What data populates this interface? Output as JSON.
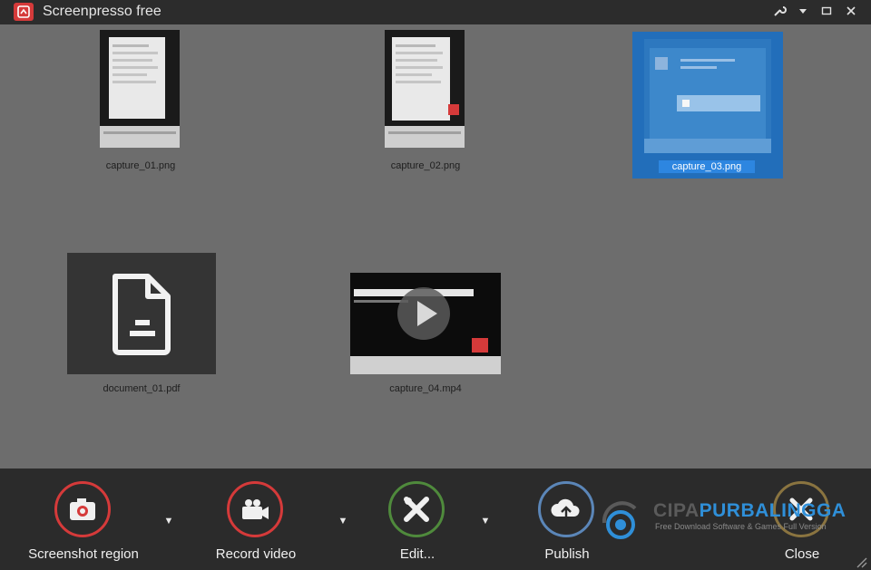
{
  "window": {
    "title": "Screenpresso free"
  },
  "titlebar_controls": [
    {
      "name": "settings-wrench-icon",
      "glyph": "🔧"
    },
    {
      "name": "menu-dropdown-icon",
      "glyph": "▾"
    },
    {
      "name": "maximize-icon",
      "glyph": "▭"
    },
    {
      "name": "close-window-icon",
      "glyph": "✕"
    }
  ],
  "gallery": {
    "items": [
      {
        "name": "capture_01.png",
        "type": "image"
      },
      {
        "name": "capture_02.png",
        "type": "image"
      },
      {
        "name": "capture_03.png",
        "type": "image",
        "selected": true
      },
      {
        "name": "document_01.pdf",
        "type": "document"
      },
      {
        "name": "capture_04.mp4",
        "type": "video"
      }
    ]
  },
  "toolbar": {
    "screenshot_label": "Screenshot region",
    "record_label": "Record video",
    "edit_label": "Edit...",
    "publish_label": "Publish",
    "close_label": "Close",
    "dropdown_glyph": "▼"
  },
  "watermark": {
    "brand_a": "CIPA",
    "brand_b": "PURBALINGGA",
    "tagline": "Free Download Software & Games Full Version"
  },
  "colors": {
    "accent_red": "#d53a3a",
    "edit_green": "#4f8a3c",
    "publish_blue": "#5b86b8",
    "close_gold": "#8a7440",
    "selection_blue": "#1f6fbf"
  }
}
